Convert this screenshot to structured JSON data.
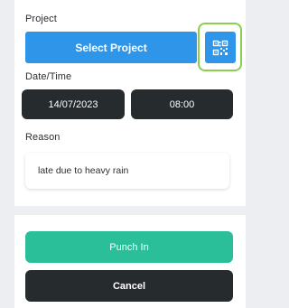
{
  "project": {
    "label": "Project",
    "select_button_label": "Select Project",
    "scan_icon": "qr-code-scan-icon"
  },
  "datetime": {
    "label": "Date/Time",
    "date_value": "14/07/2023",
    "time_value": "08:00"
  },
  "reason": {
    "label": "Reason",
    "value": "late due to heavy rain"
  },
  "actions": {
    "punch_in_label": "Punch In",
    "cancel_label": "Cancel"
  },
  "colors": {
    "primary_blue": "#2f95e8",
    "dark_button": "#262b2d",
    "punch_green": "#2bbf99",
    "highlight_green": "#8ccf4f"
  }
}
